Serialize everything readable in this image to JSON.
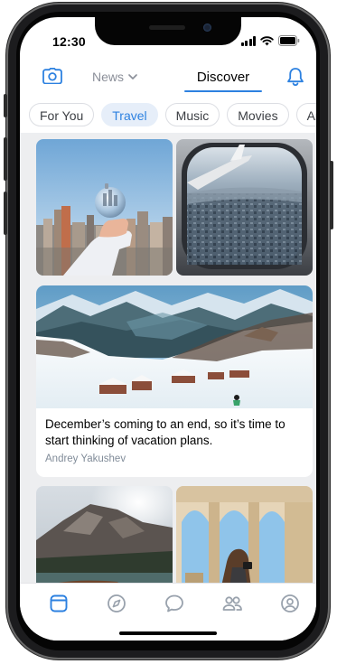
{
  "status_bar": {
    "time": "12:30"
  },
  "header": {
    "camera_icon": "camera-icon",
    "news_tab": "News",
    "news_chevron": "chevron-down-icon",
    "discover_tab": "Discover",
    "bell_icon": "bell-icon"
  },
  "chips": [
    {
      "label": "For You",
      "active": false
    },
    {
      "label": "Travel",
      "active": true
    },
    {
      "label": "Music",
      "active": false
    },
    {
      "label": "Movies",
      "active": false
    },
    {
      "label": "Art",
      "active": false
    }
  ],
  "post": {
    "text": "December’s coming to an end, so it’s time to start thinking of vacation plans.",
    "author": "Andrey Yakushev"
  },
  "tabbar": [
    {
      "icon": "news-feed-icon",
      "active": true
    },
    {
      "icon": "compass-icon",
      "active": false
    },
    {
      "icon": "messages-icon",
      "active": false
    },
    {
      "icon": "friends-icon",
      "active": false
    },
    {
      "icon": "profile-icon",
      "active": false
    }
  ],
  "colors": {
    "accent": "#2d81e0",
    "chip_active_bg": "#e6eef9",
    "muted": "#818c99",
    "feed_bg": "#edeef0"
  }
}
